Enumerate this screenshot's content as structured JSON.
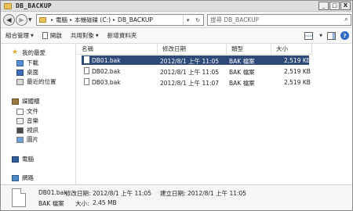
{
  "window": {
    "title": "DB_BACKUP",
    "buttons": [
      "_",
      "□",
      "X"
    ]
  },
  "address": {
    "crumbs": [
      "電腦",
      "本機磁碟 (C:)",
      "DB_BACKUP"
    ]
  },
  "search": {
    "placeholder": "搜尋 DB_BACKUP"
  },
  "toolbar": {
    "organize": "組合管理",
    "open": "開啟",
    "share": "共用對象",
    "new_folder": "新增資料夾"
  },
  "nav": {
    "favorites": "我的最愛",
    "downloads": "下載",
    "desktop": "桌面",
    "recent": "最近的位置",
    "libraries": "媒體櫃",
    "documents": "文件",
    "music": "音樂",
    "videos": "視訊",
    "pictures": "圖片",
    "computer": "電腦",
    "network": "網路"
  },
  "columns": {
    "name": "名稱",
    "modified": "修改日期",
    "type": "類型",
    "size": "大小"
  },
  "files": [
    {
      "name": "DB01.bak",
      "modified": "2012/8/1 上午 11:05",
      "type": "BAK 檔案",
      "size": "2,519 KB"
    },
    {
      "name": "DB02.bak",
      "modified": "2012/8/1 上午 11:05",
      "type": "BAK 檔案",
      "size": "2,519 KB"
    },
    {
      "name": "DB03.bak",
      "modified": "2012/8/1 上午 11:07",
      "type": "BAK 檔案",
      "size": "2,519 KB"
    }
  ],
  "details": {
    "name": "DB01.bak",
    "modified_label": "修改日期:",
    "modified_value": "2012/8/1 上午 11:05",
    "created_label": "建立日期:",
    "created_value": "2012/8/1 上午 11:05",
    "type": "BAK 檔案",
    "size_label": "大小:",
    "size_value": "2.45 MB"
  }
}
